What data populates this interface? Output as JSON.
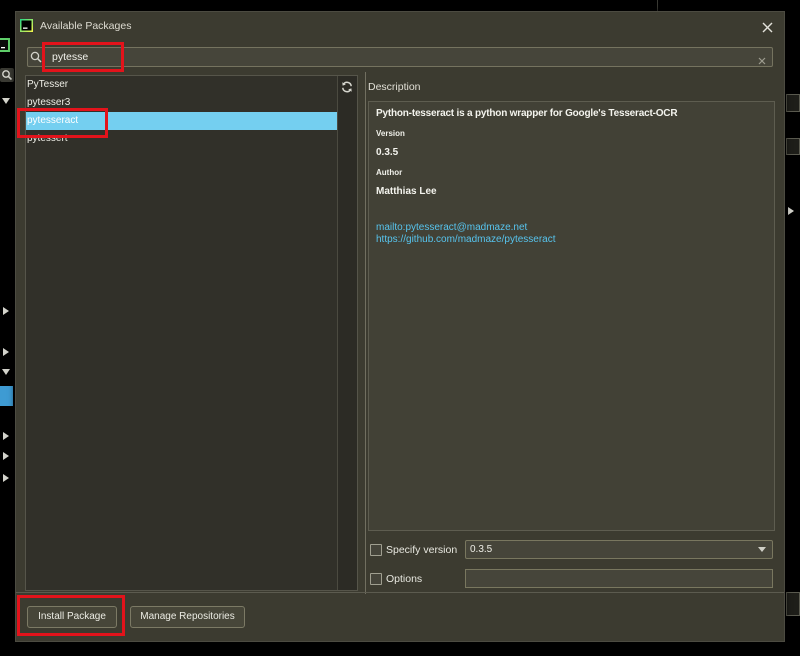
{
  "window": {
    "title": "Available Packages"
  },
  "search": {
    "value": "pytesse"
  },
  "packages": {
    "items": [
      {
        "name": "PyTesser",
        "selected": false
      },
      {
        "name": "pytesser3",
        "selected": false
      },
      {
        "name": "pytesseract",
        "selected": true
      },
      {
        "name": "pytessert",
        "selected": false
      }
    ]
  },
  "description": {
    "label": "Description",
    "summary": "Python-tesseract is a python wrapper for Google's Tesseract-OCR",
    "version_label": "Version",
    "version": "0.3.5",
    "author_label": "Author",
    "author": "Matthias Lee",
    "links": [
      "mailto:pytesseract@madmaze.net",
      "https://github.com/madmaze/pytesseract"
    ]
  },
  "install_options": {
    "specify_version": {
      "label": "Specify version",
      "checked": false,
      "selected_value": "0.3.5"
    },
    "options": {
      "label": "Options",
      "checked": false,
      "value": ""
    }
  },
  "buttons": {
    "install": "Install Package",
    "manage_repositories": "Manage Repositories"
  },
  "icons": {
    "app": "pycharm-icon",
    "close": "close-icon",
    "search": "search-icon",
    "clear": "clear-search-icon",
    "refresh": "refresh-icon",
    "dropdown": "chevron-down-icon"
  },
  "colors": {
    "selection": "#74cff0",
    "link": "#57c4ee",
    "annotation": "#e3131b",
    "dialog_background": "#3c3b30"
  }
}
